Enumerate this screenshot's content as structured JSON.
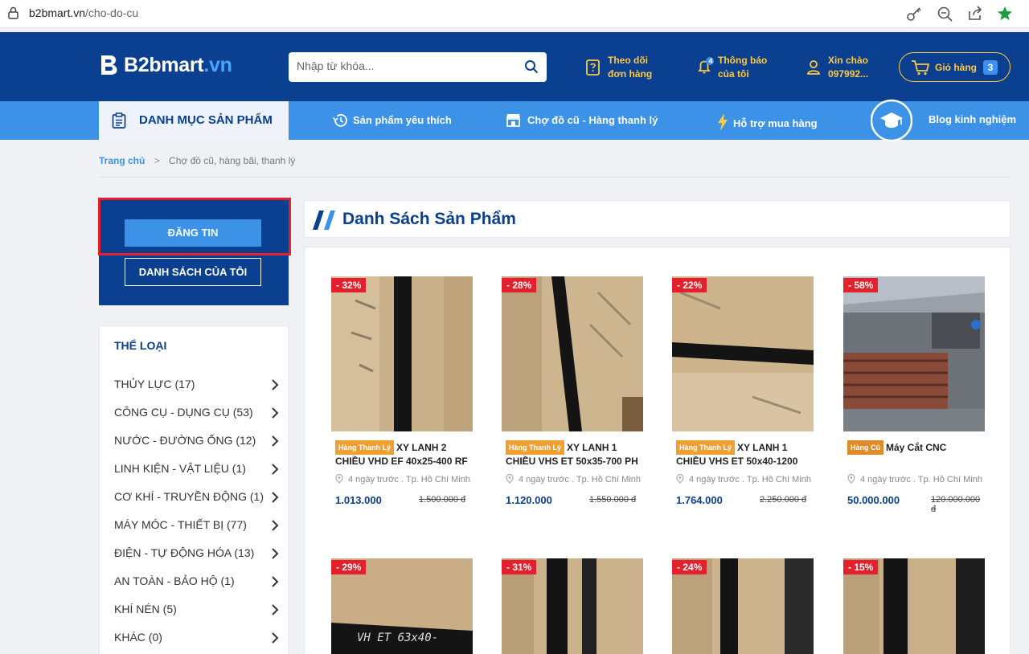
{
  "browser": {
    "url_host": "b2bmart.vn",
    "url_path": "/cho-do-cu"
  },
  "header": {
    "logo_text": "B2bmart",
    "logo_suffix": ".vn",
    "search_placeholder": "Nhập từ khóa...",
    "track_order": [
      "Theo dõi",
      "đơn hàng"
    ],
    "notifications": [
      "Thông báo",
      "của tôi"
    ],
    "notification_count": "4",
    "greeting": [
      "Xin chào",
      "097992..."
    ],
    "cart_label": "Giỏ hàng",
    "cart_count": "3"
  },
  "nav": {
    "category_label": "DANH MỤC SẢN PHẨM",
    "items": [
      "Sản phẩm yêu thích",
      "Chợ đồ cũ - Hàng thanh lý",
      "Hỗ trợ mua hàng",
      "Blog kinh nghiệm"
    ]
  },
  "breadcrumb": {
    "home": "Trang chủ",
    "current": "Chợ đồ cũ, hàng bãi, thanh lý"
  },
  "sidebar": {
    "post_button": "ĐĂNG TIN",
    "my_list_button": "DANH SÁCH CỦA TÔI",
    "categories_title": "THỂ LOẠI",
    "categories": [
      "THỦY LỰC (17)",
      "CÔNG CỤ - DỤNG CỤ (53)",
      "NƯỚC - ĐƯỜNG ỐNG (12)",
      "LINH KIỆN - VẬT LIỆU (1)",
      "CƠ KHÍ - TRUYỀN ĐỘNG (1)",
      "MÁY MÓC - THIẾT BỊ (77)",
      "ĐIỆN - TỰ ĐỘNG HÓA (13)",
      "AN TOÀN - BẢO HỘ (1)",
      "KHÍ NÉN (5)",
      "KHÁC (0)"
    ]
  },
  "products_title": "Danh Sách Sản Phẩm",
  "products": [
    {
      "discount": "- 32%",
      "tag": "Hàng Thanh Lý",
      "tag_color": "#f0a030",
      "name": "XY LANH 2 CHIỀU VHD EF 40x25-400 RF",
      "meta": "4 ngày trước . Tp. Hồ Chí Minh",
      "price": "1.013.000",
      "old_price": "1.500.000 đ"
    },
    {
      "discount": "- 28%",
      "tag": "Hàng Thanh Lý",
      "tag_color": "#f0a030",
      "name": "XY LANH 1 CHIỀU VHS ET 50x35-700 PH",
      "meta": "4 ngày trước . Tp. Hồ Chí Minh",
      "price": "1.120.000",
      "old_price": "1.550.000 đ"
    },
    {
      "discount": "- 22%",
      "tag": "Hàng Thanh Lý",
      "tag_color": "#f0a030",
      "name": "XY LANH 1 CHIỀU VHS ET 50x40-1200",
      "meta": "4 ngày trước . Tp. Hồ Chí Minh",
      "price": "1.764.000",
      "old_price": "2.250.000 đ"
    },
    {
      "discount": "- 58%",
      "tag": "Hàng Cũ",
      "tag_color": "#e08a2a",
      "name": "Máy Cắt CNC",
      "meta": "4 ngày trước . Tp. Hồ Chí Minh",
      "price": "50.000.000",
      "old_price": "120.000.000 đ"
    },
    {
      "discount": "- 29%"
    },
    {
      "discount": "- 31%"
    },
    {
      "discount": "- 24%"
    },
    {
      "discount": "- 15%"
    }
  ],
  "colors": {
    "primary": "#0b3f8f",
    "accent": "#3c92e6",
    "highlight": "#ffc940",
    "sale": "#e3202b"
  }
}
